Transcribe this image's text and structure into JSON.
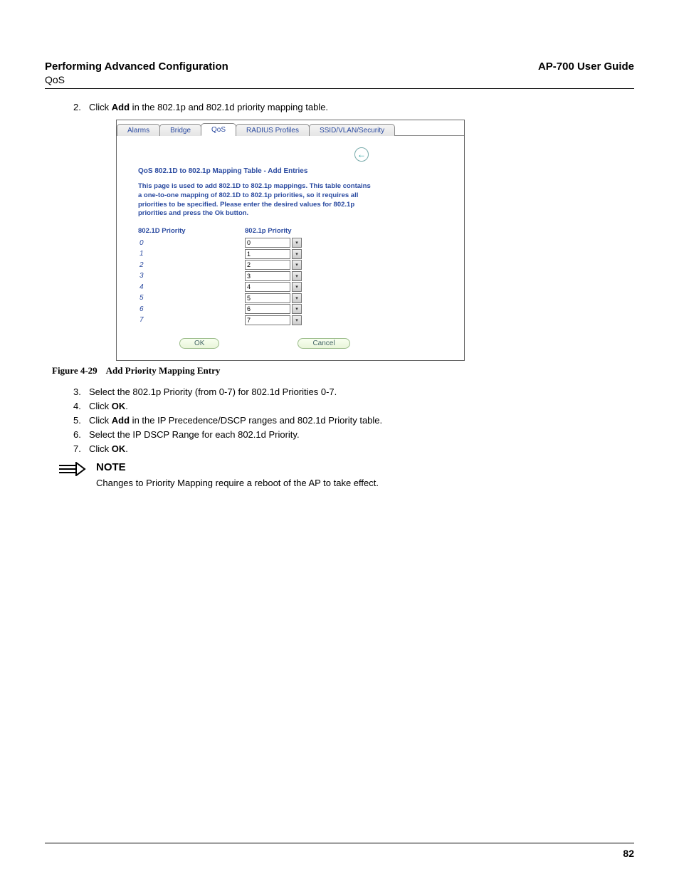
{
  "header": {
    "section_title": "Performing Advanced Configuration",
    "guide_title": "AP-700 User Guide",
    "subsection": "QoS"
  },
  "steps_a": [
    {
      "num": "2.",
      "pre": "Click ",
      "bold": "Add",
      "post": " in the 802.1p and 802.1d priority mapping table."
    }
  ],
  "screenshot": {
    "tabs": [
      "Alarms",
      "Bridge",
      "QoS",
      "RADIUS Profiles",
      "SSID/VLAN/Security"
    ],
    "active_tab_index": 2,
    "back_glyph": "←",
    "panel_title": "QoS 802.1D to 802.1p Mapping Table - Add Entries",
    "panel_desc": "This page is used to add 802.1D to 802.1p mappings. This table contains a one-to-one mapping of 802.1D to 802.1p priorities, so it requires all priorities to be specified. Please enter the desired values for 802.1p priorities and press the Ok button.",
    "col1_header": "802.1D Priority",
    "col2_header": "802.1p Priority",
    "rows": [
      {
        "d": "0",
        "p": "0"
      },
      {
        "d": "1",
        "p": "1"
      },
      {
        "d": "2",
        "p": "2"
      },
      {
        "d": "3",
        "p": "3"
      },
      {
        "d": "4",
        "p": "4"
      },
      {
        "d": "5",
        "p": "5"
      },
      {
        "d": "6",
        "p": "6"
      },
      {
        "d": "7",
        "p": "7"
      }
    ],
    "ok_label": "OK",
    "cancel_label": "Cancel"
  },
  "figure": {
    "number": "Figure 4-29",
    "title": "Add Priority Mapping Entry"
  },
  "steps_b": [
    {
      "num": "3.",
      "text": "Select the 802.1p Priority (from 0-7) for 802.1d Priorities 0-7."
    },
    {
      "num": "4.",
      "pre": "Click ",
      "bold": "OK",
      "post": "."
    },
    {
      "num": "5.",
      "pre": "Click ",
      "bold": "Add",
      "post": " in the IP Precedence/DSCP ranges and 802.1d Priority table."
    },
    {
      "num": "6.",
      "text": "Select the IP DSCP Range for each 802.1d Priority."
    },
    {
      "num": "7.",
      "pre": "Click ",
      "bold": "OK",
      "post": "."
    }
  ],
  "note": {
    "heading": "NOTE",
    "body": "Changes to Priority Mapping require a reboot of the AP to take effect."
  },
  "page_number": "82"
}
